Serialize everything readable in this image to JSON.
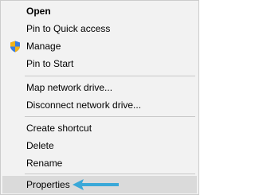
{
  "context_menu": {
    "items": [
      {
        "label": "Open"
      },
      {
        "label": "Pin to Quick access"
      },
      {
        "label": "Manage",
        "icon": "uac-shield-icon"
      },
      {
        "label": "Pin to Start"
      },
      {
        "label": "Map network drive..."
      },
      {
        "label": "Disconnect network drive..."
      },
      {
        "label": "Create shortcut"
      },
      {
        "label": "Delete"
      },
      {
        "label": "Rename"
      },
      {
        "label": "Properties",
        "highlighted": true
      }
    ],
    "highlight_color": "#dadada",
    "annotation_arrow_color": "#3aa8d8"
  }
}
